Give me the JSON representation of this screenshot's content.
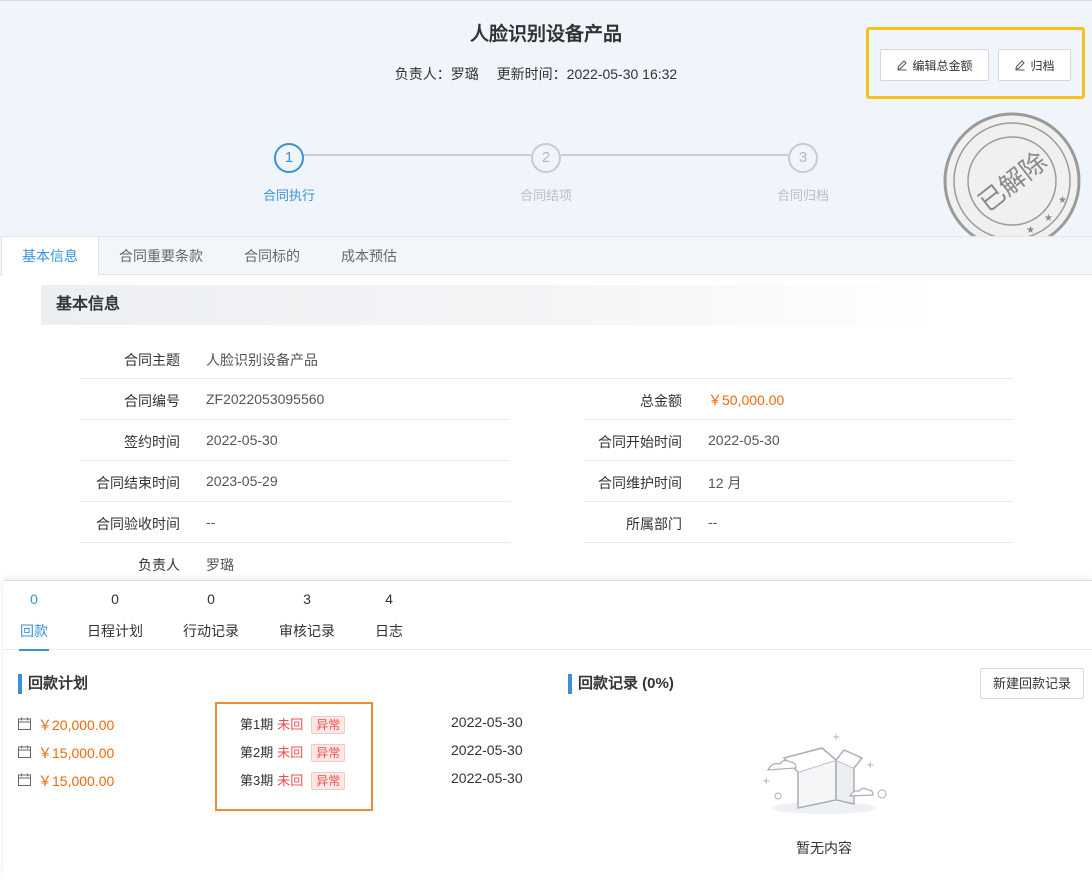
{
  "header": {
    "title": "人脸识别设备产品",
    "owner_label": "负责人：",
    "owner": "罗璐",
    "updated_label": "更新时间：",
    "updated": "2022-05-30 16:32",
    "buttons": {
      "edit_amount": "编辑总金额",
      "archive": "归档"
    },
    "seal_text": "已解除"
  },
  "steps": [
    {
      "num": "1",
      "label": "合同执行",
      "active": true
    },
    {
      "num": "2",
      "label": "合同结项",
      "active": false
    },
    {
      "num": "3",
      "label": "合同归档",
      "active": false
    }
  ],
  "tabs": [
    "基本信息",
    "合同重要条款",
    "合同标的",
    "成本预估"
  ],
  "basic": {
    "section_title": "基本信息",
    "fields": {
      "subject": {
        "label": "合同主题",
        "value": "人脸识别设备产品"
      },
      "number": {
        "label": "合同编号",
        "value": "ZF2022053095560"
      },
      "total": {
        "label": "总金额",
        "value": "￥50,000.00"
      },
      "sign_date": {
        "label": "签约时间",
        "value": "2022-05-30"
      },
      "start_date": {
        "label": "合同开始时间",
        "value": "2022-05-30"
      },
      "end_date": {
        "label": "合同结束时间",
        "value": "2023-05-29"
      },
      "maintain": {
        "label": "合同维护时间",
        "value": "12 月"
      },
      "accept_date": {
        "label": "合同验收时间",
        "value": "--"
      },
      "dept": {
        "label": "所属部门",
        "value": "--"
      },
      "owner": {
        "label": "负责人",
        "value": "罗璐"
      }
    }
  },
  "panel_tabs": [
    {
      "count": "0",
      "label": "回款"
    },
    {
      "count": "0",
      "label": "日程计划"
    },
    {
      "count": "0",
      "label": "行动记录"
    },
    {
      "count": "3",
      "label": "审核记录"
    },
    {
      "count": "4",
      "label": "日志"
    }
  ],
  "payment_plan": {
    "title": "回款计划",
    "rows": [
      {
        "amount": "￥20,000.00",
        "period": "第1期",
        "status": "未回",
        "badge": "异常",
        "date": "2022-05-30"
      },
      {
        "amount": "￥15,000.00",
        "period": "第2期",
        "status": "未回",
        "badge": "异常",
        "date": "2022-05-30"
      },
      {
        "amount": "￥15,000.00",
        "period": "第3期",
        "status": "未回",
        "badge": "异常",
        "date": "2022-05-30"
      }
    ]
  },
  "payment_records": {
    "title": "回款记录 (0%)",
    "new_button": "新建回款记录",
    "empty_text": "暂无内容"
  }
}
